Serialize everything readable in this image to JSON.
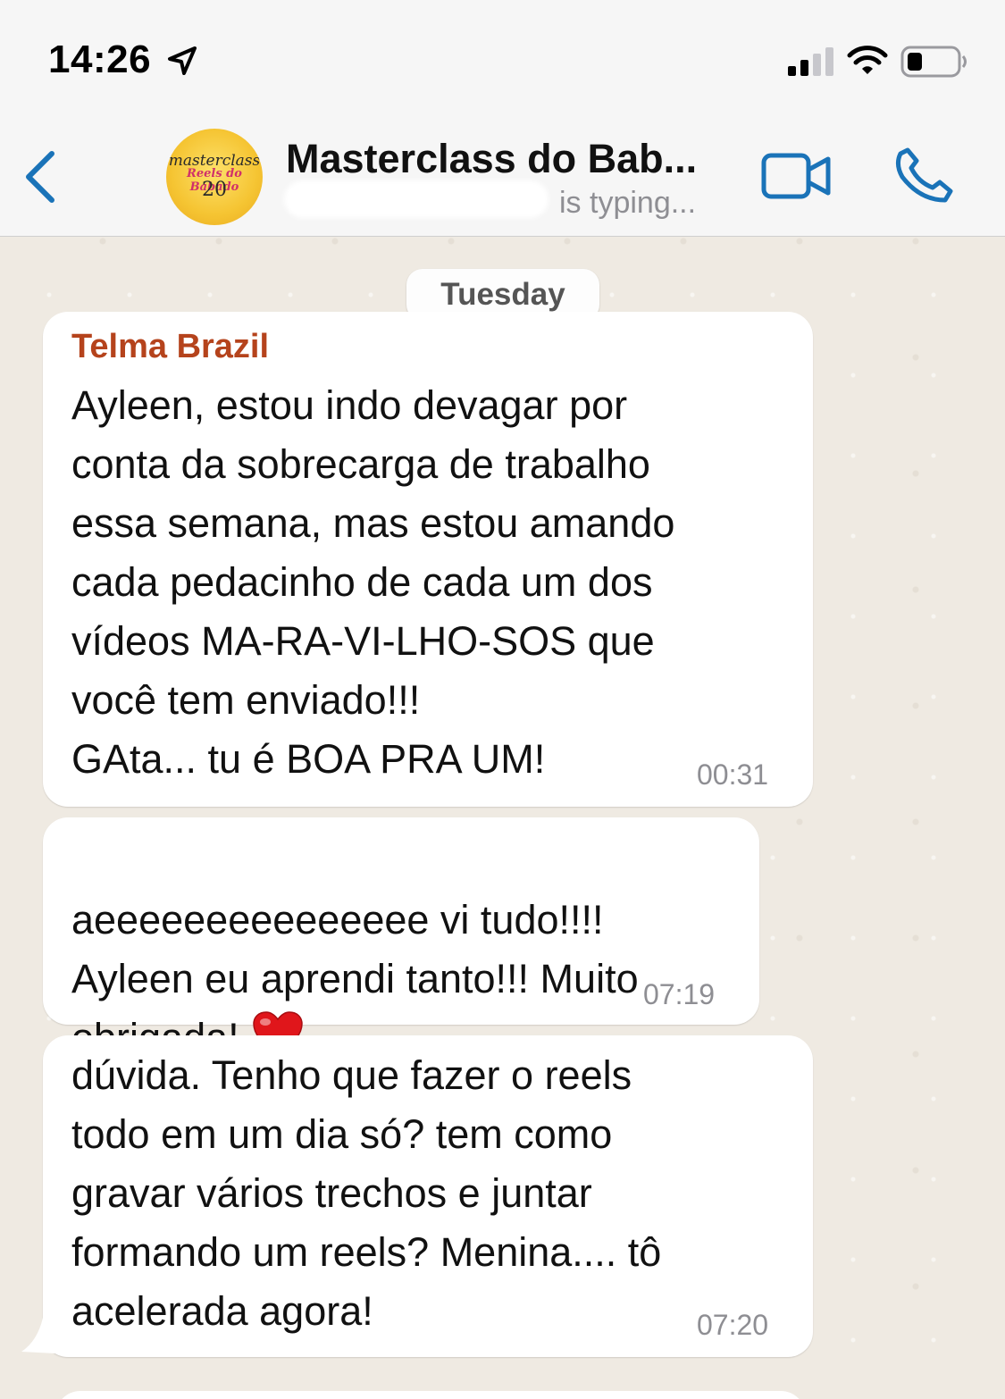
{
  "status_bar": {
    "time": "14:26",
    "icons": [
      "location-arrow-icon",
      "cellular-signal-icon",
      "wifi-icon",
      "battery-icon"
    ]
  },
  "header": {
    "back_icon": "chevron-left-icon",
    "avatar": {
      "line1": "masterclass",
      "line2": "Reels do Babado",
      "line3": "20"
    },
    "title": "Masterclass do Bab...",
    "subtitle": "is typing...",
    "video_icon": "video-camera-icon",
    "call_icon": "phone-icon",
    "accent_color": "#1a73b8"
  },
  "chat": {
    "day_label": "Tuesday",
    "messages": [
      {
        "sender": "Telma Brazil",
        "text": "Ayleen, estou indo devagar por\nconta da sobrecarga de trabalho\nessa semana, mas estou amando\ncada pedacinho de cada um dos\nvídeos MA-RA-VI-LHO-SOS que\nvocê tem enviado!!!\nGAta... tu é BOA PRA UM!",
        "time": "00:31"
      },
      {
        "text": "aeeeeeeeeeeeeeee vi tudo!!!!\nAyleen eu aprendi tanto!!! Muito\nobrigada!",
        "emoji": "heart-icon",
        "time": "07:19"
      },
      {
        "text": "dúvida. Tenho que fazer o reels\ntodo em um dia só? tem como\ngravar vários trechos e juntar\nformando um reels? Menina.... tô\nacelerada agora!",
        "time": "07:20"
      }
    ]
  },
  "colors": {
    "sender_name": "#b5431c",
    "chat_background": "#efeae2",
    "bubble": "#ffffff"
  }
}
